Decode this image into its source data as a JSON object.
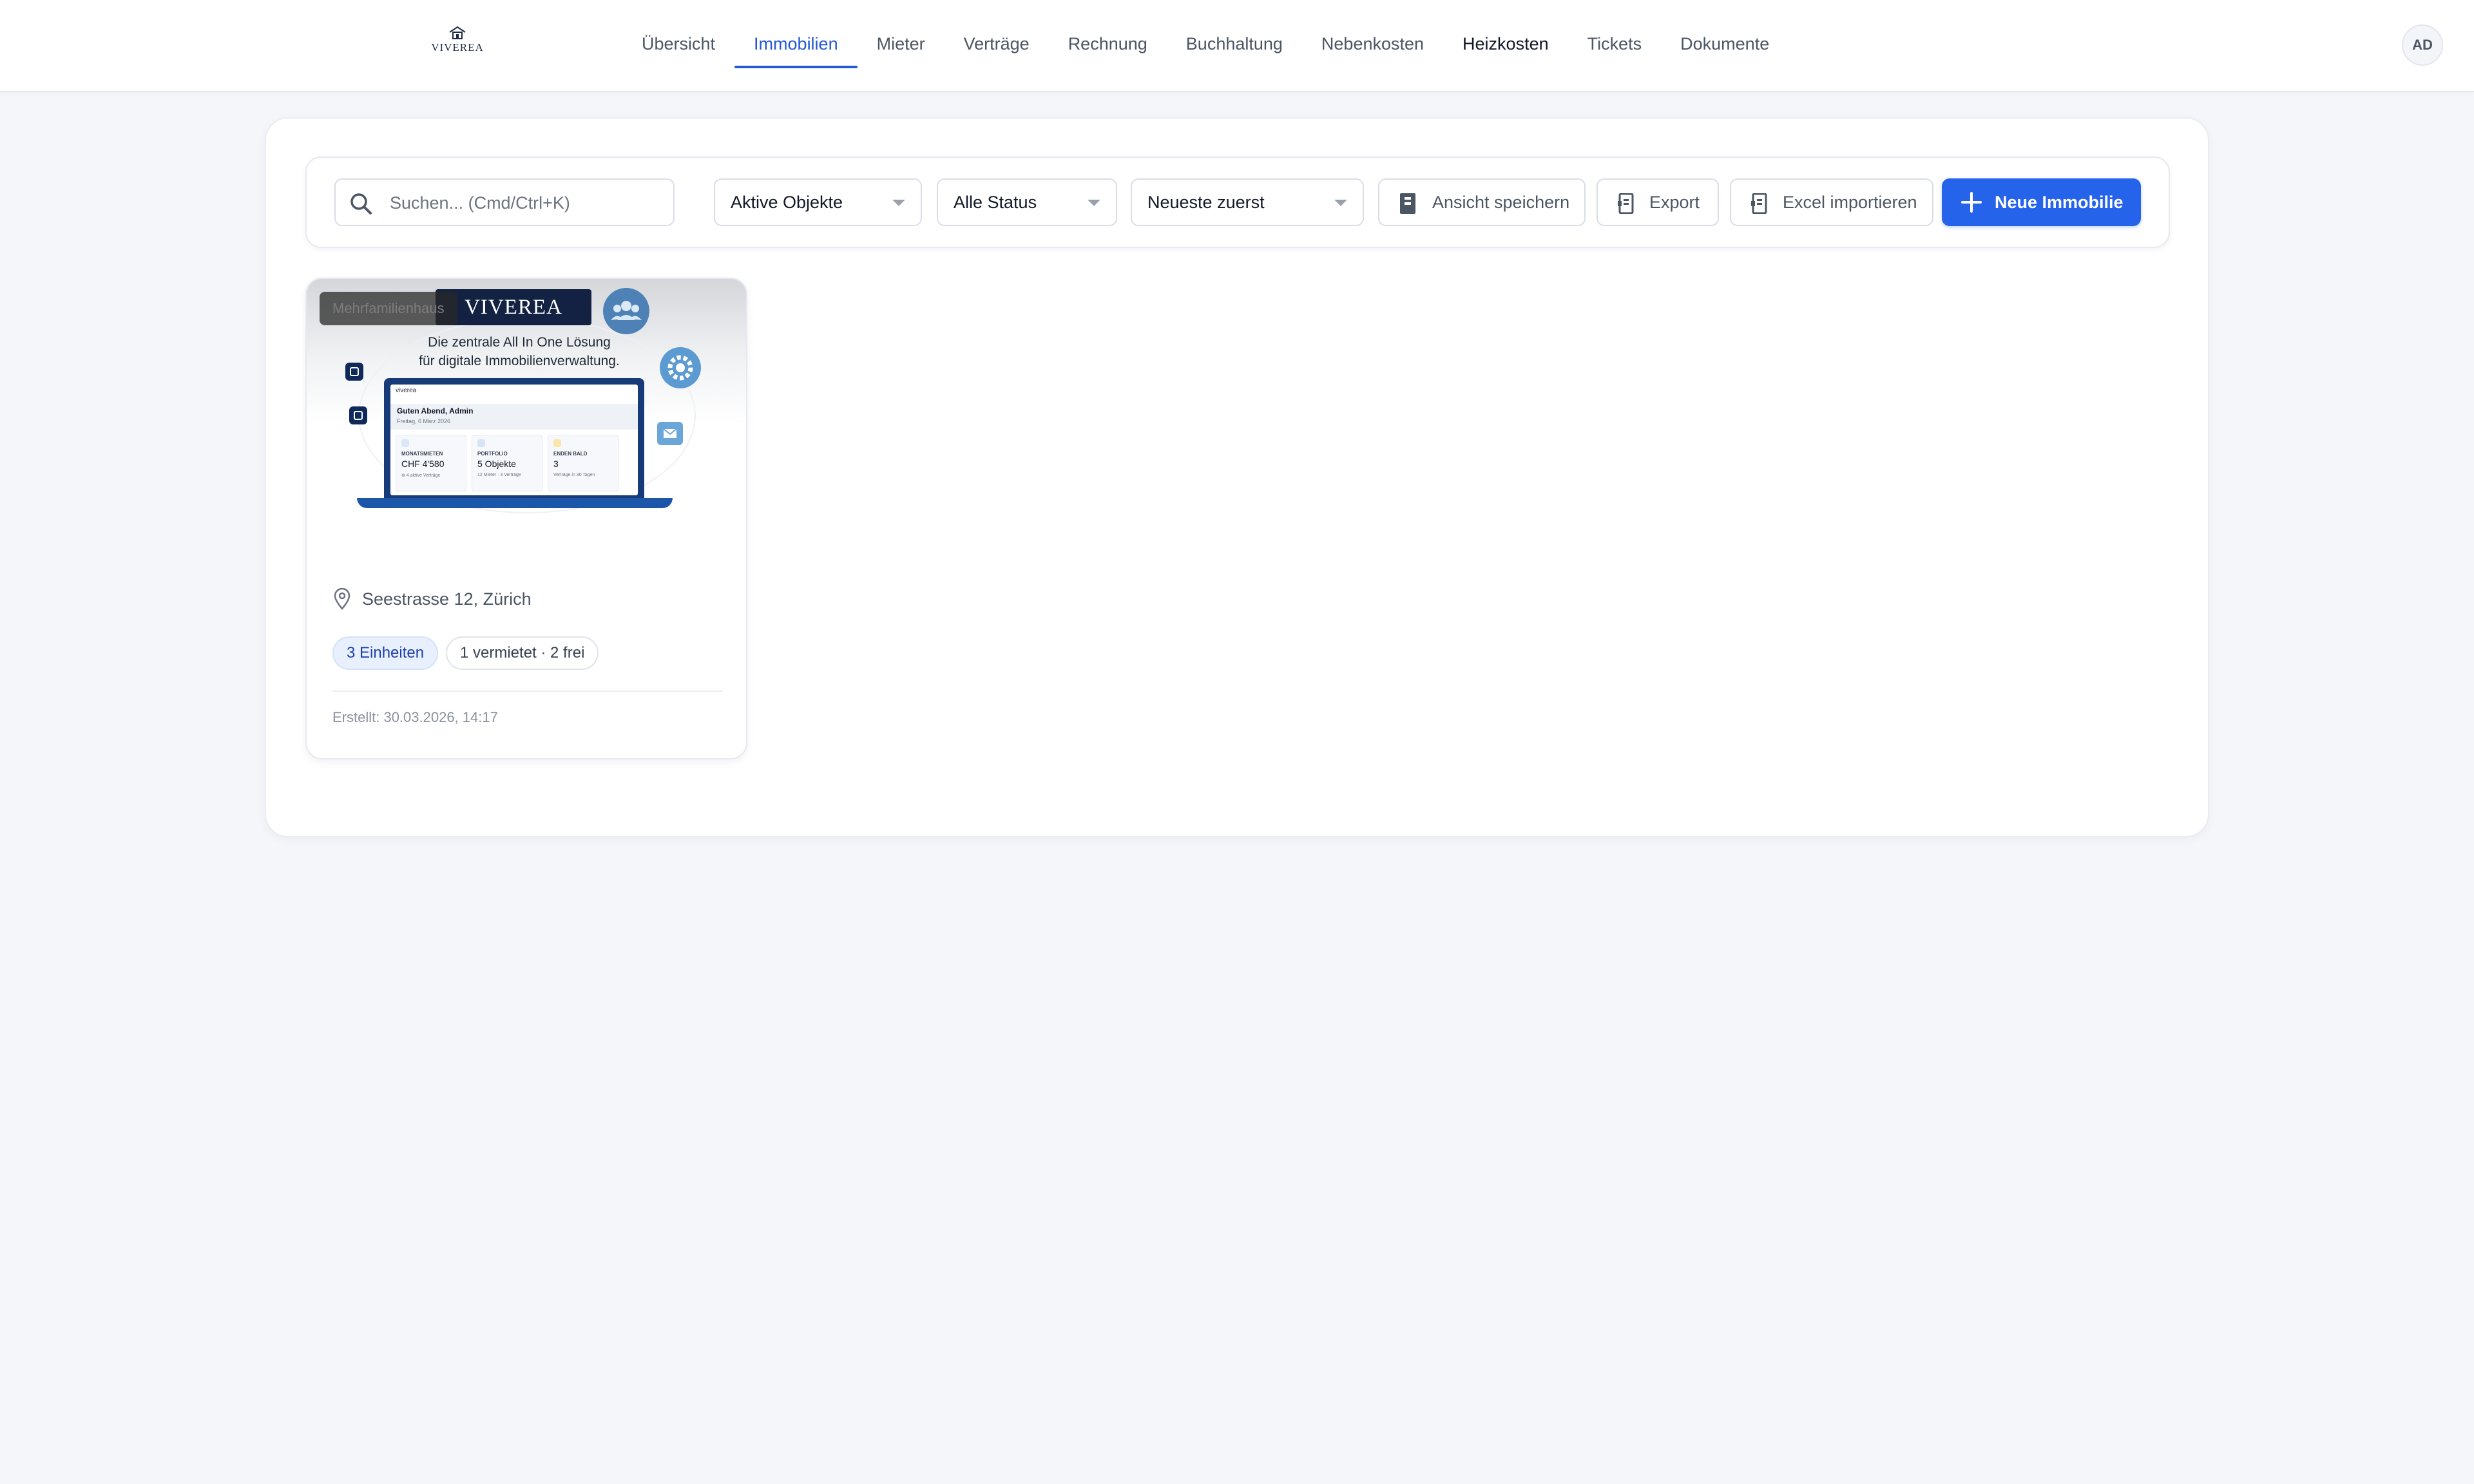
{
  "brand": {
    "logo_text": "VIVEREA"
  },
  "nav": {
    "items": [
      {
        "label": "Übersicht"
      },
      {
        "label": "Immobilien"
      },
      {
        "label": "Mieter"
      },
      {
        "label": "Verträge"
      },
      {
        "label": "Rechnung"
      },
      {
        "label": "Buchhaltung"
      },
      {
        "label": "Nebenkosten"
      },
      {
        "label": "Heizkosten"
      },
      {
        "label": "Tickets"
      },
      {
        "label": "Dokumente"
      }
    ],
    "active_index": 1
  },
  "user": {
    "initials": "AD"
  },
  "toolbar": {
    "search_placeholder": "Suchen... (Cmd/Ctrl+K)",
    "search_value": "",
    "filter_objects": "Aktive Objekte",
    "filter_status": "Alle Status",
    "sort": "Neueste zuerst",
    "save_view_label": "Ansicht speichern",
    "export_label": "Export",
    "import_label": "Excel importieren",
    "new_label": "Neue Immobilie"
  },
  "properties": [
    {
      "type": "Mehrfamilienhaus",
      "address": "Seestrasse 12, Zürich",
      "units": "3 Einheiten",
      "occupancy": "1 vermietet · 2 frei",
      "created": "Erstellt: 30.03.2026, 14:17",
      "image": {
        "logo": "VIVEREA",
        "tagline_1": "Die zentrale All In One Lösung",
        "tagline_2": "für digitale Immobilienverwaltung.",
        "app_name": "viverea",
        "greeting": "Guten Abend, Admin",
        "date": "Freitag, 6 März 2026",
        "kpis": [
          {
            "label": "MONATSMIETEN",
            "value": "CHF 4'580",
            "sub": "⊕ 4 aktive Verträge"
          },
          {
            "label": "PORTFOLIO",
            "value": "5 Objekte",
            "sub": "12 Mieter · 3 Verträge"
          },
          {
            "label": "ENDEN BALD",
            "value": "3",
            "sub": "Verträge in 30 Tagen"
          }
        ]
      }
    }
  ],
  "colors": {
    "accent": "#2563eb",
    "nav_active": "#2458d6",
    "background": "#f5f6f9",
    "pill_blue_bg": "#e9f0fd"
  },
  "icons": {
    "search": "search-icon",
    "save_view": "bookmark-icon",
    "export": "export-icon",
    "import": "import-icon",
    "new": "plus-icon",
    "address": "map-pin-icon"
  }
}
